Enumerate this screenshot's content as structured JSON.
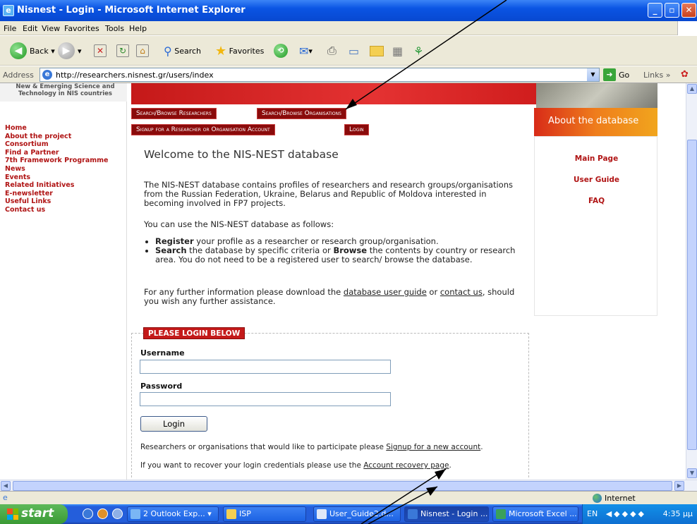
{
  "window": {
    "title": "Nisnest - Login - Microsoft Internet Explorer"
  },
  "menu": [
    "File",
    "Edit",
    "View",
    "Favorites",
    "Tools",
    "Help"
  ],
  "toolbar": {
    "back": "Back",
    "search": "Search",
    "favorites": "Favorites"
  },
  "address": {
    "label": "Address",
    "url": "http://researchers.nisnest.gr/users/index",
    "go": "Go",
    "links": "Links"
  },
  "sidebar": {
    "logo": "New & Emerging Science and Technology in NIS countries",
    "nav": [
      "Home",
      "About the project",
      "Consortium",
      "Find a Partner",
      "7th Framework Programme",
      "News",
      "Events",
      "Related Initiatives",
      "E-newsletter",
      "Useful Links",
      "Contact us"
    ]
  },
  "topnav": {
    "search_researchers": "Search/Browse Researchers",
    "search_orgs": "Search/Browse Organisations",
    "signup": "Signup for a Researcher or Organisation Account",
    "login": "Login"
  },
  "right": {
    "about": "About the database",
    "links": [
      "Main Page",
      "User Guide",
      "FAQ"
    ]
  },
  "main": {
    "title": "Welcome to the NIS-NEST database",
    "intro": "The NIS-NEST database contains profiles of researchers and research groups/organisations from the Russian Federation, Ukraine, Belarus and Republic of Moldova interested in becoming involved in FP7 projects.",
    "use_as": "You can use the NIS-NEST database as follows:",
    "bullet1_bold": "Register",
    "bullet1": " your profile as a researcher or research group/organisation.",
    "bullet2_bold1": "Search",
    "bullet2_mid": " the database by specific criteria or ",
    "bullet2_bold2": "Browse",
    "bullet2": " the contents by country or research area. You do not need to be a registered user to search/ browse the database.",
    "further_1": "For any further information please download the ",
    "guide_link": "database user guide",
    "further_2": " or ",
    "contact_link": "contact us",
    "further_3": ", should you wish any further assistance."
  },
  "login": {
    "header": "PLEASE LOGIN BELOW",
    "username_label": "Username",
    "username_value": "",
    "password_label": "Password",
    "password_value": "",
    "button": "Login",
    "signup_text": "Researchers or organisations that would like to participate please ",
    "signup_link": "Signup for a new account",
    "recover_text": "If you want to recover your login credentials please use the ",
    "recover_link": "Account recovery page"
  },
  "status": {
    "zone": "Internet"
  },
  "taskbar": {
    "start": "start",
    "tasks": [
      "2 Outlook Exp...",
      "ISP",
      "User_Guide2.d...",
      "Nisnest - Login ...",
      "Microsoft Excel ..."
    ],
    "lang": "EN",
    "clock": "4:35 μμ"
  },
  "colors": {
    "brand_red": "#b01414",
    "xp_blue": "#0a54e3"
  }
}
